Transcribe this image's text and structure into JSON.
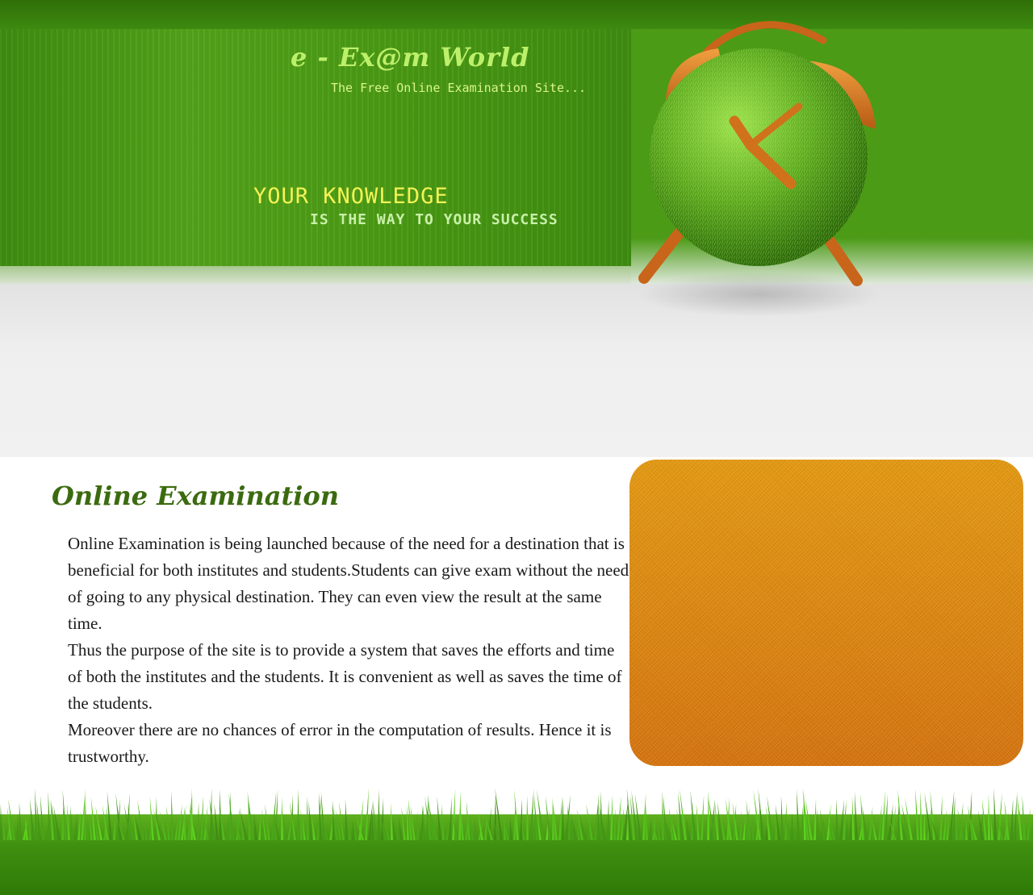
{
  "header": {
    "site_title": "e - Ex@m World",
    "tagline": "The Free Online Examination Site...",
    "slogan_line1": "YOUR KNOWLEDGE",
    "slogan_line2": "IS THE WAY TO YOUR SUCCESS"
  },
  "content": {
    "heading": "Online Examination",
    "paragraphs": [
      "Online Examination is being launched because of the need for a destination that is beneficial for both institutes and students.Students can give exam without the need of going to any physical destination. They can even view the result at the same time.",
      "Thus the purpose of the site is to provide a system that saves the efforts and time of both the institutes and the students. It is convenient as well as saves the time of the students.",
      "Moreover there are no chances of error in the computation of results. Hence it is trustworthy."
    ]
  },
  "colors": {
    "header_green": "#4a9c16",
    "title_green": "#bdf06a",
    "slogan_yellow": "#f3f255",
    "heading_green": "#3b6b0f",
    "panel_orange": "#e08a0e",
    "clock_orange": "#c8651a"
  },
  "icons": {
    "clock": "grass-alarm-clock-icon",
    "grass": "grass-strip"
  }
}
